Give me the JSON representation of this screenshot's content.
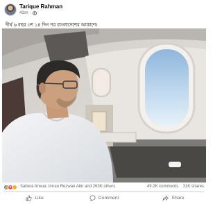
{
  "post": {
    "author": "Tarique Rahman",
    "time": "43m",
    "privacy_icon": "globe-icon",
    "caption": "দীর্ঘ ৬ বছর ৩শ ১৪ দিন পর বাংলাদেশের আকাশে।"
  },
  "photo": {
    "subject": "man in white shirt looking out airplane window"
  },
  "reactions": {
    "icons": [
      "like-icon",
      "love-icon",
      "care-icon"
    ],
    "names": "Sabera Anwar, Imran Rezwan Abir and 263K others",
    "comments": "49.2K comments",
    "shares": "31K shares"
  },
  "actions": {
    "like": "Like",
    "comment": "Comment",
    "share": "Share"
  },
  "colors": {
    "text_primary": "#050505",
    "text_secondary": "#65676b",
    "like_blue": "#1877f2",
    "love_red": "#f33e58",
    "care_yellow": "#f7b125",
    "divider": "#ced0d4"
  }
}
